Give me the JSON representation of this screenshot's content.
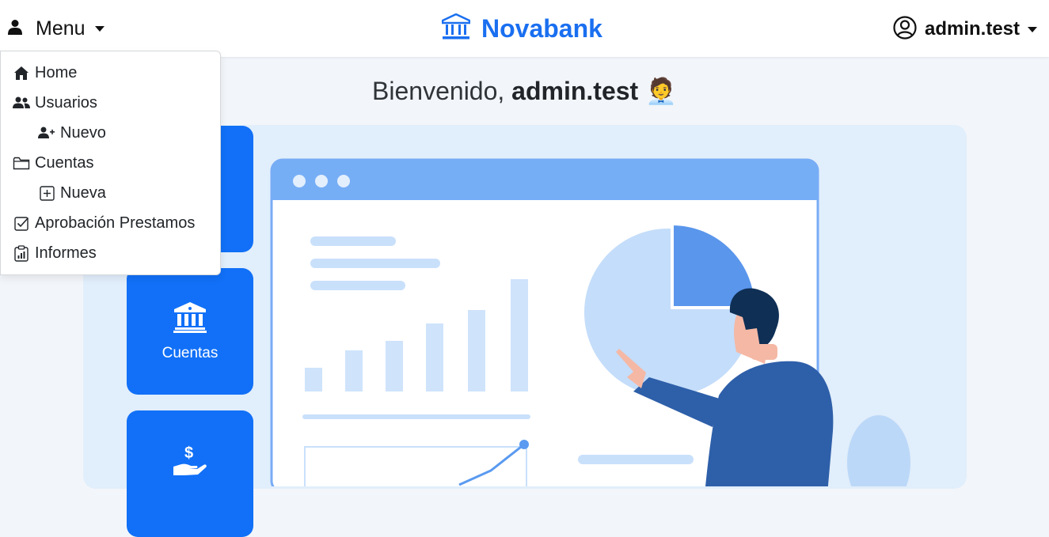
{
  "navbar": {
    "menu_label": "Menu",
    "brand": "Novabank",
    "user": "admin.test"
  },
  "dropdown": {
    "items": [
      {
        "label": "Home",
        "icon": "house-icon"
      },
      {
        "label": "Usuarios",
        "icon": "users-icon"
      },
      {
        "label": "Nuevo",
        "icon": "user-plus-icon"
      },
      {
        "label": "Cuentas",
        "icon": "folder-icon"
      },
      {
        "label": "Nueva",
        "icon": "plus-square-icon"
      },
      {
        "label": "Aprobación Prestamos",
        "icon": "check-square-icon"
      },
      {
        "label": "Informes",
        "icon": "clipboard-chart-icon"
      }
    ]
  },
  "welcome": {
    "greeting": "Bienvenido,",
    "username": "admin.test",
    "emoji": "🧑‍💼"
  },
  "tiles": [
    {
      "label": "",
      "icon": "users-icon"
    },
    {
      "label": "Cuentas",
      "icon": "bank-icon"
    },
    {
      "label": "",
      "icon": "hand-dollar-icon"
    }
  ],
  "colors": {
    "brand": "#1a6ff0",
    "tile": "#1170f7",
    "panel": "#e1eefb"
  }
}
